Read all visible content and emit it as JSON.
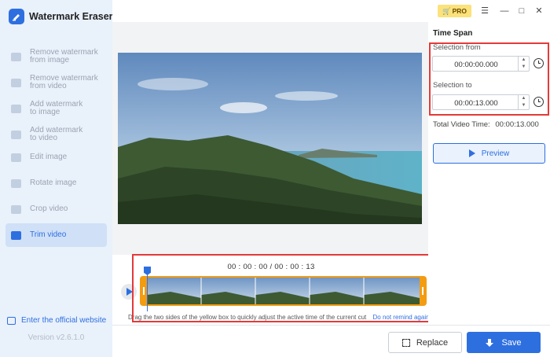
{
  "app": {
    "title": "Watermark Eraser"
  },
  "titlebar": {
    "pro_label": "PRO"
  },
  "sidebar": {
    "items": [
      {
        "label": "Remove watermark from image",
        "line1": "Remove watermark",
        "line2": "from image",
        "active": false
      },
      {
        "label": "Remove watermark from video",
        "line1": "Remove watermark",
        "line2": "from video",
        "active": false
      },
      {
        "label": "Add watermark to image",
        "line1": "Add watermark",
        "line2": "to image",
        "active": false
      },
      {
        "label": "Add watermark to video",
        "line1": "Add watermark",
        "line2": "to video",
        "active": false
      },
      {
        "label": "Edit image",
        "line1": "Edit image",
        "line2": "",
        "active": false
      },
      {
        "label": "Rotate image",
        "line1": "Rotate image",
        "line2": "",
        "active": false
      },
      {
        "label": "Crop video",
        "line1": "Crop video",
        "line2": "",
        "active": false
      },
      {
        "label": "Trim video",
        "line1": "Trim video",
        "line2": "",
        "active": true
      }
    ],
    "official_link": "Enter the official website",
    "version": "Version v2.6.1.0"
  },
  "timeline": {
    "time_display": "00 : 00 : 00 / 00 : 00 : 13",
    "hint": "Drag the two sides of the yellow box to quickly adjust the active time of the current cut",
    "hint_link": "Do not remind again"
  },
  "time_span": {
    "title": "Time Span",
    "from_label": "Selection from",
    "from_value": "00:00:00.000",
    "to_label": "Selection to",
    "to_value": "00:00:13.000",
    "total_label": "Total Video Time:",
    "total_value": "00:00:13.000",
    "preview_label": "Preview"
  },
  "actions": {
    "replace_label": "Replace",
    "save_label": "Save"
  },
  "colors": {
    "accent": "#2e6fe0",
    "highlight": "#e33a3a",
    "trim_frame": "#f39c12",
    "pro": "#fbe27a"
  }
}
